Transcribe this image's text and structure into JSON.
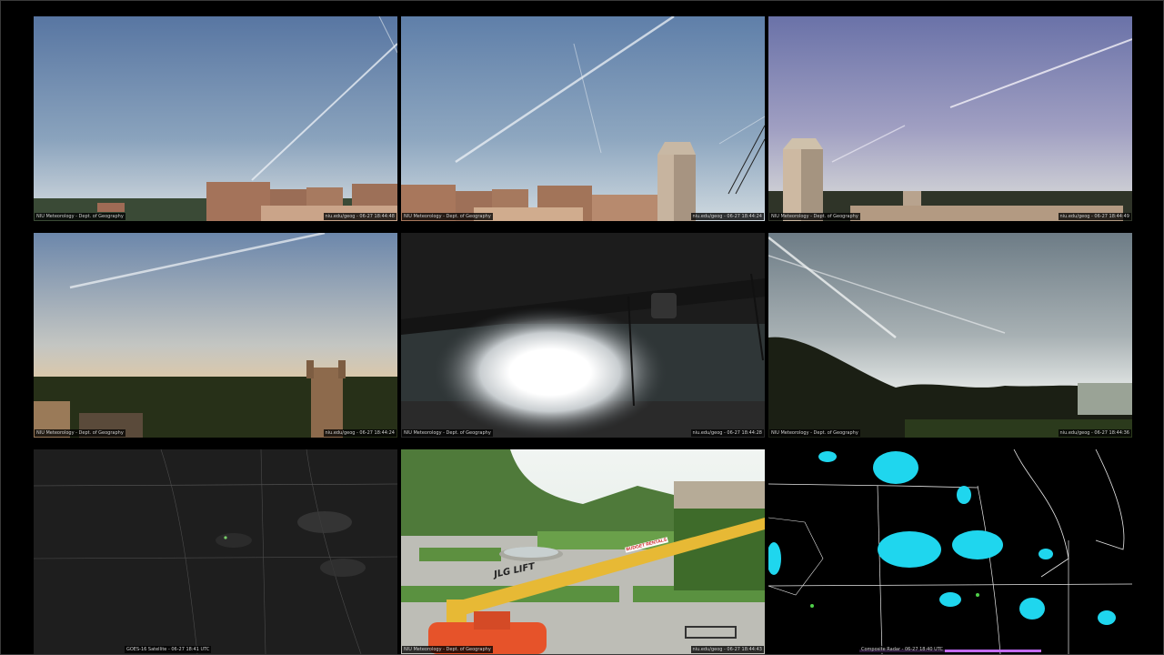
{
  "tiles": [
    {
      "id": "t1",
      "caption_left": "NIU Meteorology - Dept. of Geography",
      "caption_right": "niu.edu/geog - 06-27 18:44:48"
    },
    {
      "id": "t2",
      "caption_left": "NIU Meteorology - Dept. of Geography",
      "caption_right": "niu.edu/geog - 06-27 18:44:24"
    },
    {
      "id": "t3",
      "caption_left": "NIU Meteorology - Dept. of Geography",
      "caption_right": "niu.edu/geog - 06-27 18:44:49"
    },
    {
      "id": "t4",
      "caption_left": "NIU Meteorology - Dept. of Geography",
      "caption_right": "niu.edu/geog - 06-27 18:44:24"
    },
    {
      "id": "t5",
      "caption_left": "NIU Meteorology - Dept. of Geography",
      "caption_right": "niu.edu/geog - 06-27 18:44:28"
    },
    {
      "id": "t6",
      "caption_left": "NIU Meteorology - Dept. of Geography",
      "caption_right": "niu.edu/geog - 06-27 18:44:36"
    },
    {
      "id": "t7",
      "caption_center": "GOES-16 Satellite - 06-27 18:41 UTC"
    },
    {
      "id": "t8",
      "caption_left": "NIU Meteorology - Dept. of Geography",
      "caption_right": "niu.edu/geog - 06-27 18:44:43",
      "lift_label": "JLG LIFT",
      "sign_label": "BUDGET RENTALS"
    },
    {
      "id": "t9",
      "caption_center": "Composite Radar - 06-27 18:40 UTC"
    }
  ],
  "colors": {
    "background": "#000000",
    "sky_top": "#5f7fa8",
    "sky_bottom": "#c9d3dc",
    "radar_cyan": "#1fd6ee",
    "lift_yellow": "#e7b935",
    "lift_orange": "#e6532a"
  },
  "icons": [
    "sun-glare",
    "camera-mount",
    "tower-building"
  ]
}
